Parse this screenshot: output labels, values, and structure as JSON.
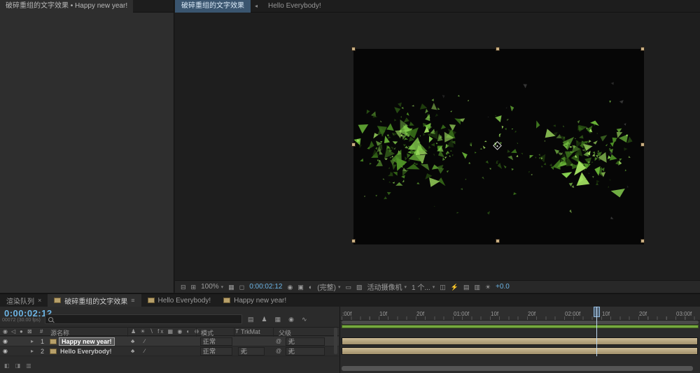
{
  "colors": {
    "accent_blue": "#6cb4e4",
    "label_tan": "#b7a06a",
    "work_area_green": "#76a940"
  },
  "icons": {
    "dropdown": "▾",
    "close": "×",
    "menu": "≡",
    "back": "◂",
    "expand": "▸",
    "eye": "◉",
    "audio": "◁",
    "solo": "●",
    "lock": "⊠",
    "clover": "♣",
    "slash": "∕",
    "always_preview": "⊟",
    "primary_viewer": "⊞",
    "grid_guides": "▦",
    "mask_vis": "◻",
    "snapshot": "◉",
    "show_snapshot": "▣",
    "channels": "◐",
    "roi": "▭",
    "transp_grid": "▨",
    "pixel_aspect": "◫",
    "fast_preview": "⚡",
    "tl_button": "▤",
    "flowchart_btn": "▥",
    "exposure": "☀",
    "mini_flowchart": "▤",
    "shy": "♟",
    "frame_blend": "▦",
    "motion_blur": "◉",
    "graph_editor": "∿",
    "toggle_switches": "◧",
    "toggle_transfer": "◨",
    "toggle_inout": "▥"
  },
  "project_panel": {
    "tab_label": "破碎重组的文字效果 • Happy new year!"
  },
  "viewer": {
    "tab_active": "破碎重组的文字效果",
    "tab_inactive": "Hello Everybody!",
    "toolbar": {
      "zoom": "100%",
      "timecode": "0:00:02:12",
      "resolution": "(完整)",
      "camera_view": "活动摄像机",
      "view_layout": "1 个...",
      "exposure": "+0.0"
    }
  },
  "comp": {
    "bg": "#060606",
    "particle_colors": [
      "#24470f",
      "#39701a",
      "#4f9426",
      "#69b338",
      "#86cf4f",
      "#a3e262"
    ]
  },
  "timeline": {
    "tabs": {
      "render_queue": "渲染队列",
      "active": "破碎重组的文字效果",
      "comp2": "Hello Everybody!",
      "comp3": "Happy new year!"
    },
    "timecode": "0:00:02:12",
    "frame_info": "00072 (30.00 fps)",
    "columns": {
      "number": "#",
      "source_name": "源名称",
      "switches": "♟ ☀ ∖ fx ▦ ◉ ◐ ⊕",
      "mode": "模式",
      "trkmat_t": "T",
      "trkmat": "TrkMat",
      "parent": "父级"
    },
    "layers": [
      {
        "num": "1",
        "name": "Happy new year!",
        "mode": "正常",
        "trkmat": "",
        "parent": "无"
      },
      {
        "num": "2",
        "name": "Hello Everybody!",
        "mode": "正常",
        "trkmat": "无",
        "parent": "无"
      }
    ],
    "ruler_labels": [
      ":00f",
      "10f",
      "20f",
      "01:00f",
      "10f",
      "20f",
      "02:00f",
      "10f",
      "20f",
      "03:00f"
    ]
  }
}
